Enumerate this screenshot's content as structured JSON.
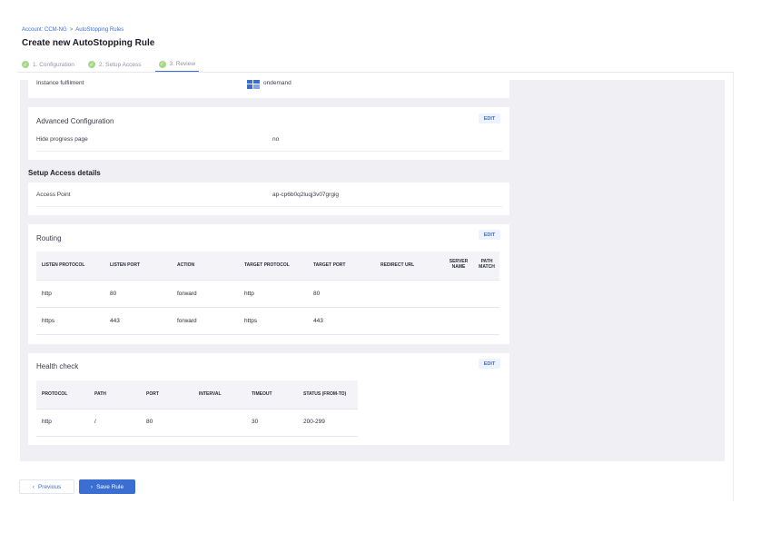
{
  "breadcrumb": {
    "account": "Account: CCM-NG",
    "separator": ">",
    "page": "AutoStopping Rules"
  },
  "page_title": "Create new AutoStopping Rule",
  "steps": [
    {
      "label": "1. Configuration"
    },
    {
      "label": "2. Setup Access"
    },
    {
      "label": "3. Review"
    }
  ],
  "instance": {
    "label": "Instance fulfilment",
    "value": "ondemand",
    "icon": "ondemand-icon"
  },
  "advanced": {
    "title": "Advanced Configuration",
    "edit_label": "EDIT",
    "hide_progress_label": "Hide progress page",
    "hide_progress_value": "no"
  },
  "setup_access": {
    "heading": "Setup Access details",
    "access_point_label": "Access Point",
    "access_point_value": "ap-cp6b0q2luqj3v07grgig"
  },
  "routing": {
    "title": "Routing",
    "edit_label": "EDIT",
    "columns": [
      "LISTEN PROTOCOL",
      "LISTEN PORT",
      "ACTION",
      "TARGET PROTOCOL",
      "TARGET PORT",
      "REDIRECT URL",
      "SERVER NAME",
      "PATH MATCH"
    ],
    "rows": [
      [
        "http",
        "80",
        "forward",
        "http",
        "80",
        "",
        "",
        ""
      ],
      [
        "https",
        "443",
        "forward",
        "https",
        "443",
        "",
        "",
        ""
      ]
    ]
  },
  "health": {
    "title": "Health check",
    "edit_label": "EDIT",
    "columns": [
      "PROTOCOL",
      "PATH",
      "PORT",
      "INTERVAL",
      "TIMEOUT",
      "STATUS (FROM-TO)"
    ],
    "rows": [
      [
        "http",
        "/",
        "80",
        "",
        "30",
        "200-299"
      ]
    ]
  },
  "footer": {
    "previous_label": "Previous",
    "save_label": "Save Rule"
  },
  "colors": {
    "accent": "#3b6ed3",
    "step_check": "#a6d88a",
    "edit_bg": "#eaf3ff",
    "panel_bg": "#efeff4"
  }
}
